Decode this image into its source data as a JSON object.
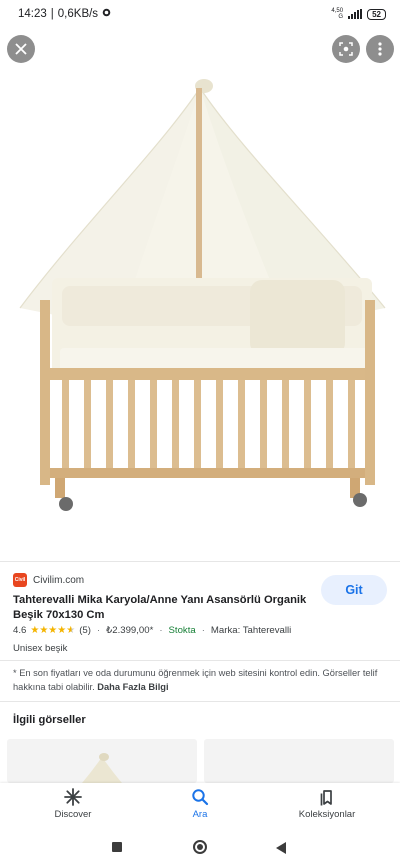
{
  "status_bar": {
    "time": "14:23",
    "network": "0,6KB/s",
    "net_speed_top": "4,50",
    "net_speed_bottom": "G",
    "battery": "52"
  },
  "product": {
    "source": "Civilim.com",
    "favicon_text": "Civil",
    "action_label": "Git",
    "title": "Tahterevalli Mika Karyola/Anne Yanı Asansörlü Organik Beşik 70x130 Cm",
    "rating": "4.6",
    "stars": 4.6,
    "reviews": "(5)",
    "price": "₺2.399,00*",
    "stock": "Stokta",
    "brand": "Marka: Tahterevalli",
    "subtitle": "Unisex beşik",
    "notice": "* En son fiyatları ve oda durumunu öğrenmek için web sitesini kontrol edin. Görseller telif hakkına tabi olabilir.",
    "more_info": "Daha Fazla Bilgi"
  },
  "related": {
    "title": "İlgili görseller"
  },
  "bottom_nav": {
    "discover": "Discover",
    "search": "Ara",
    "collections": "Koleksiyonlar"
  },
  "colors": {
    "accent": "#1a73e8",
    "stock": "#188038",
    "star": "#f4b400",
    "favicon": "#e8461f"
  }
}
